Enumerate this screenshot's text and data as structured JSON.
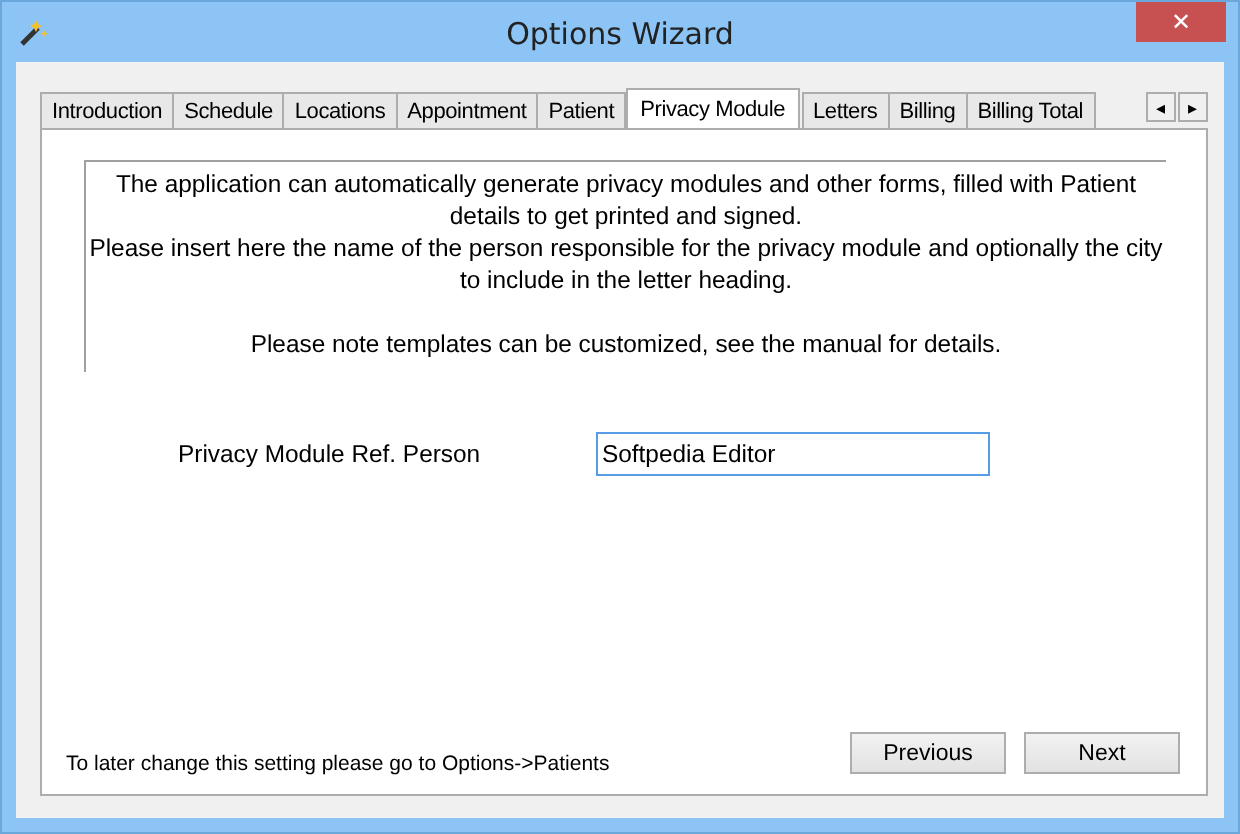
{
  "window": {
    "title": "Options Wizard",
    "close": "✕"
  },
  "tabs": [
    {
      "label": "Introduction",
      "selected": false
    },
    {
      "label": "Schedule",
      "selected": false
    },
    {
      "label": "Locations",
      "selected": false
    },
    {
      "label": "Appointment",
      "selected": false
    },
    {
      "label": "Patient",
      "selected": false
    },
    {
      "label": "Privacy Module",
      "selected": true
    },
    {
      "label": "Letters",
      "selected": false
    },
    {
      "label": "Billing",
      "selected": false
    },
    {
      "label": "Billing Total",
      "selected": false
    }
  ],
  "tab_scroll": [
    "◂",
    "▸"
  ],
  "description": [
    "The application can automatically generate privacy modules and other forms, filled with Patient details to get printed and signed.",
    "Please insert here the name of the person responsible for the privacy module and optionally the city to include in the letter heading.",
    "Please note templates can be customized, see the manual for details."
  ],
  "field": {
    "label": "Privacy Module Ref. Person",
    "value": "Softpedia Editor"
  },
  "footer_note": "To later change this setting please go to Options->Patients",
  "buttons": [
    "Previous",
    "Next"
  ]
}
